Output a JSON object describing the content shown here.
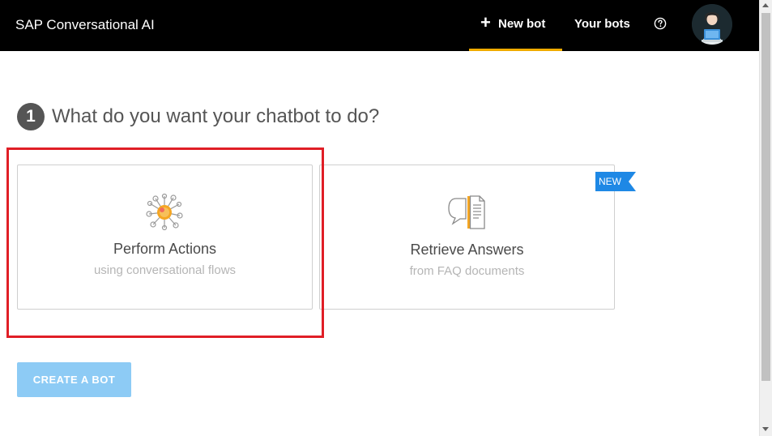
{
  "header": {
    "brand": "SAP Conversational AI",
    "nav": {
      "new_bot_label": "New bot",
      "your_bots_label": "Your bots",
      "help_icon": "question-circle-icon",
      "plus_icon": "plus-icon"
    },
    "avatar_icon": "user-avatar-icon"
  },
  "step": {
    "number": "1",
    "question": "What do you want your chatbot to do?"
  },
  "options": [
    {
      "title": "Perform Actions",
      "subtitle": "using conversational flows",
      "icon": "network-nodes-icon"
    },
    {
      "title": "Retrieve Answers",
      "subtitle": "from FAQ documents",
      "icon": "faq-document-icon",
      "badge": "NEW"
    }
  ],
  "create_button_label": "CREATE A BOT",
  "colors": {
    "header_bg": "#000000",
    "active_tab_underline": "#f0ab00",
    "highlight_border": "#e01e26",
    "new_badge": "#1e88e5",
    "create_button": "#8dcbf5",
    "step_badge": "#555555"
  }
}
